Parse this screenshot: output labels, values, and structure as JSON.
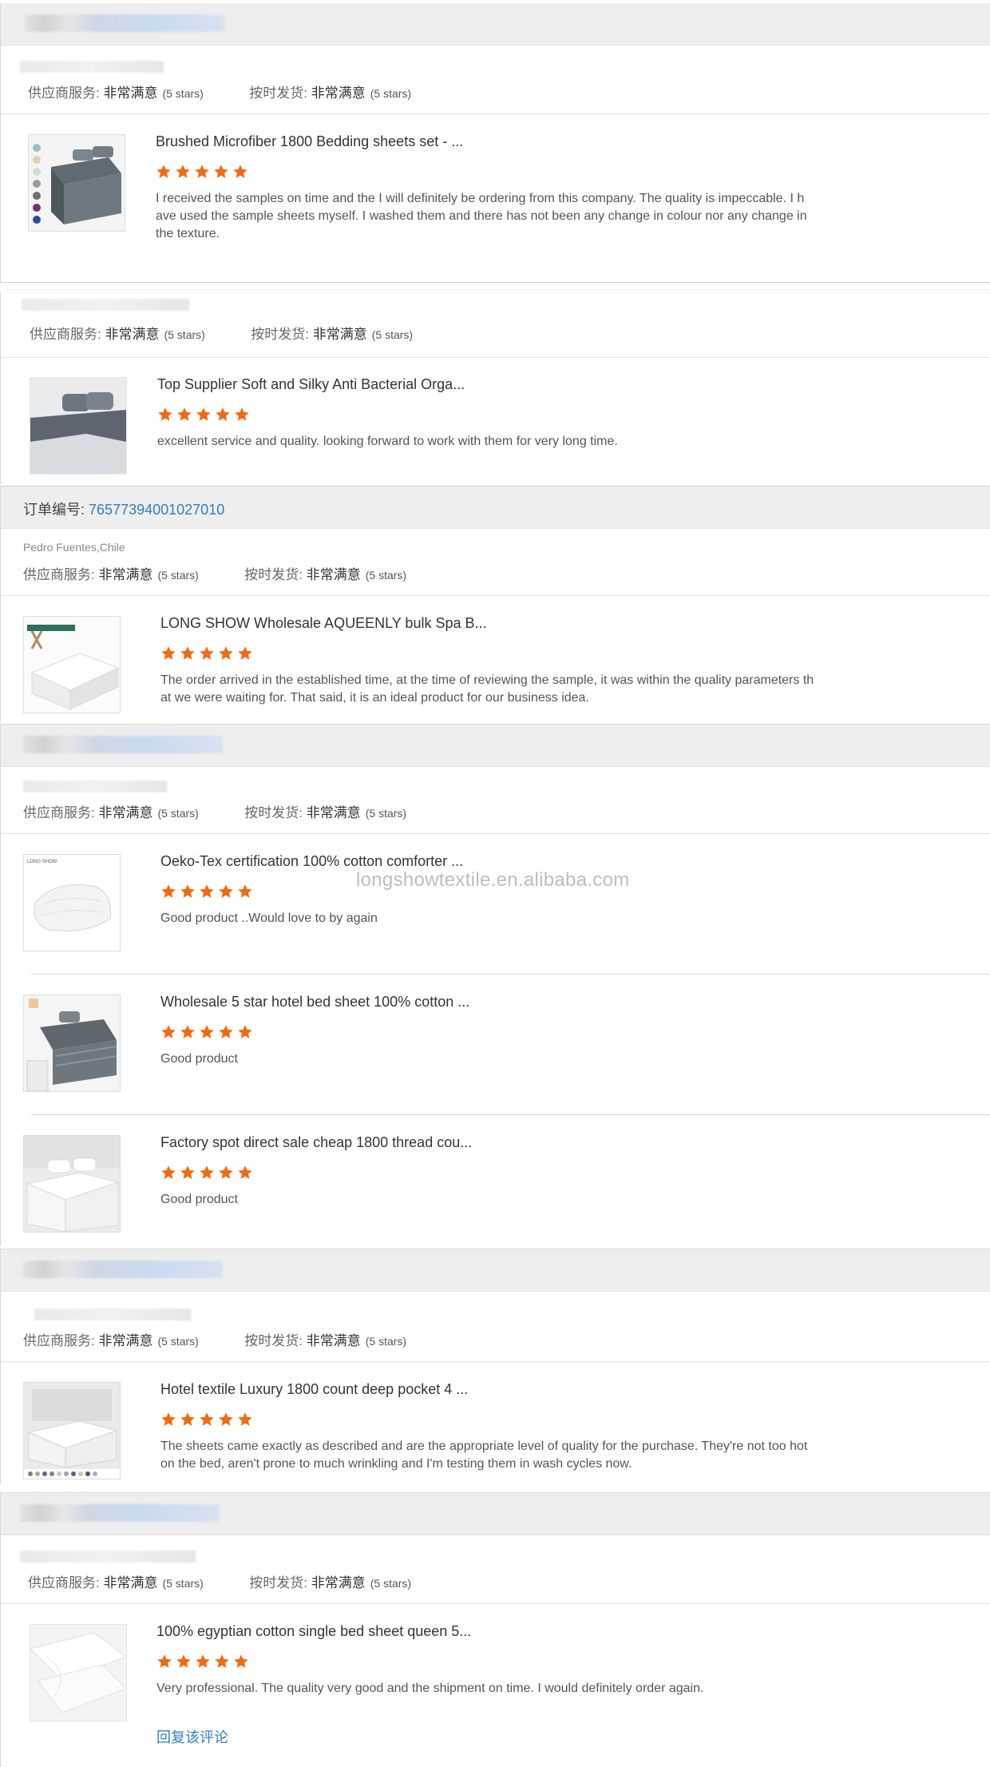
{
  "labels": {
    "supplier_service": "供应商服务:",
    "on_time_shipping": "按时发货:",
    "very_satisfied": "非常满意",
    "five_stars": "(5 stars)",
    "order_prefix": "订单编号:",
    "reply": "回复该评论"
  },
  "colors": {
    "star": "#f26a10",
    "link": "#2f7fc1",
    "header_bg": "#eeeeee"
  },
  "watermark": "longshowtextile.en.alibaba.com",
  "reviews": [
    {
      "title": "Brushed Microfiber 1800 Bedding sheets set - ...",
      "rating": 5,
      "text": "I received the samples on time and the I will definitely be ordering from this company. The quality is impeccable. I have used the sample sheets myself. I washed them and there has not been any change in colour nor any change in the texture."
    },
    {
      "title": "Top Supplier Soft and Silky Anti Bacterial Orga...",
      "rating": 5,
      "text": "excellent service and quality. looking forward to work with them for very long time."
    },
    {
      "order_number": "76577394001027010",
      "buyer": "Pedro Fuentes,Chile",
      "title": "LONG SHOW Wholesale AQUEENLY bulk Spa B...",
      "rating": 5,
      "text": "The order arrived in the established time, at the time of reviewing the sample, it was within the quality parameters that we were waiting for. That said, it is an ideal product for our business idea."
    },
    {
      "title": "Oeko-Tex certification 100% cotton comforter ...",
      "rating": 5,
      "text": "Good product ..Would love to by again",
      "thumb_label": "LONG SHOW"
    },
    {
      "title": "Wholesale 5 star hotel bed sheet 100% cotton ...",
      "rating": 5,
      "text": "Good product"
    },
    {
      "title": "Factory spot direct sale cheap 1800 thread cou...",
      "rating": 5,
      "text": "Good product"
    },
    {
      "title": "Hotel textile Luxury 1800 count deep pocket 4 ...",
      "rating": 5,
      "text": "The sheets came exactly as described and are the appropriate level of quality for the purchase.  They're not too hot on the bed, aren't prone to much wrinkling and I'm testing them in wash cycles now."
    },
    {
      "title": "100% egyptian cotton single bed sheet queen 5...",
      "rating": 5,
      "text": "Very professional. The quality very good and the shipment on time. I would definitely order again."
    }
  ]
}
